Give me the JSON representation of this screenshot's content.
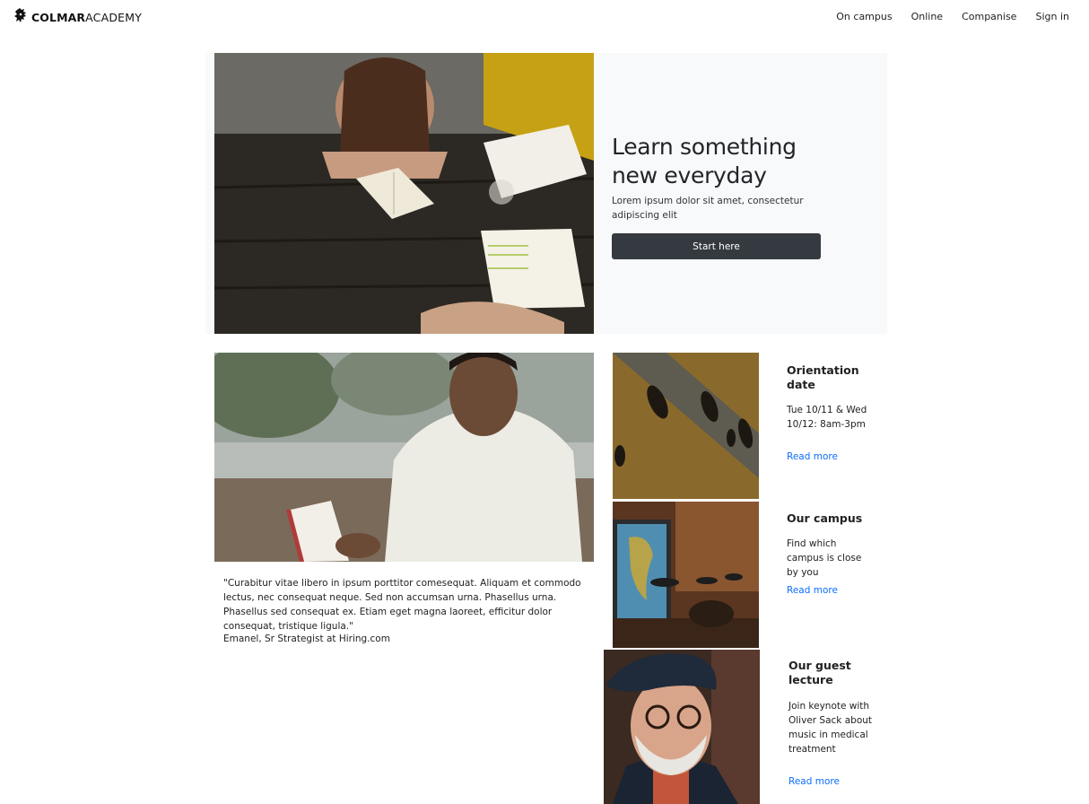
{
  "brand": {
    "bold": "COLMAR",
    "light": "ACADEMY",
    "logo_icon": "lion-icon"
  },
  "nav": {
    "items": [
      "On campus",
      "Online",
      "Companise",
      "Sign in"
    ]
  },
  "hero": {
    "image": "students-reading-at-table",
    "title_line1": "Learn something",
    "title_line2": "new everyday",
    "subtitle": "Lorem ipsum dolor sit amet, consectetur adipiscing elit",
    "button_label": "Start here"
  },
  "testimonial": {
    "image": "man-reading-book-outdoors",
    "quote": "\"Curabitur vitae libero in ipsum porttitor comesequat. Aliquam et commodo lectus, nec consequat neque. Sed non accumsan urna. Phasellus urna. Phasellus sed consequat ex. Etiam eget magna laoreet, efficitur dolor consequat, tristique ligula.\"",
    "author": "Emanel, Sr Strategist at Hiring.com"
  },
  "cards": [
    {
      "image": "people-walking-aerial",
      "title": "Orientation date",
      "text": "Tue 10/11 & Wed 10/12: 8am-3pm",
      "link": "Read more"
    },
    {
      "image": "campus-room-with-map",
      "title": "Our campus",
      "text": "Find which campus is close by you",
      "link": "Read more"
    },
    {
      "image": "elderly-man-portrait",
      "title": "Our guest lecture",
      "text": "Join keynote with Oliver Sack about music in medical treatment",
      "link": "Read more"
    }
  ],
  "colors": {
    "button_bg": "#343a40",
    "hero_bg": "#f8f9fa",
    "link": "#0d6efd"
  }
}
